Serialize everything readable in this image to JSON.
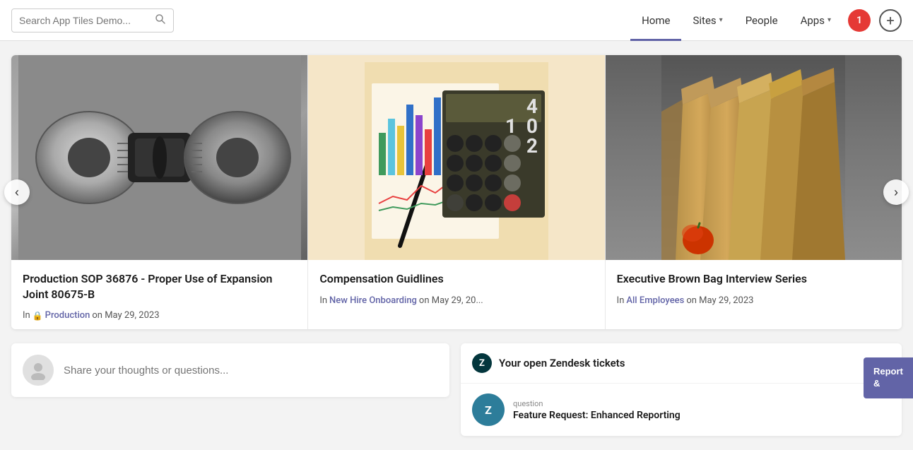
{
  "header": {
    "search_placeholder": "Search App Tiles Demo...",
    "nav_items": [
      {
        "label": "Home",
        "active": true,
        "has_dropdown": false
      },
      {
        "label": "Sites",
        "active": false,
        "has_dropdown": true
      },
      {
        "label": "People",
        "active": false,
        "has_dropdown": false
      },
      {
        "label": "Apps",
        "active": false,
        "has_dropdown": true
      }
    ],
    "user_initial": "1",
    "plus_icon": "+"
  },
  "carousel": {
    "prev_label": "‹",
    "next_label": "›",
    "cards": [
      {
        "id": "card1",
        "title": "Production SOP 36876 - Proper Use of Expansion Joint 80675-B",
        "meta_prefix": "In",
        "meta_link_text": "Production",
        "meta_suffix": "on May 29, 2023",
        "has_lock": true,
        "image_type": "mechanical"
      },
      {
        "id": "card2",
        "title": "Compensation Guidlines",
        "meta_prefix": "In",
        "meta_link_text": "New Hire Onboarding",
        "meta_suffix": "on May 29, 20...",
        "has_lock": false,
        "image_type": "chart"
      },
      {
        "id": "card3",
        "title": "Executive Brown Bag Interview Series",
        "meta_prefix": "In",
        "meta_link_text": "All Employees",
        "meta_suffix": "on May 29, 2023",
        "has_lock": false,
        "image_type": "bags"
      }
    ]
  },
  "share_box": {
    "placeholder": "Share your thoughts or questions..."
  },
  "zendesk": {
    "logo_text": "Z",
    "title": "Your open Zendesk tickets",
    "ticket": {
      "avatar_text": "Z",
      "label": "question",
      "title": "Feature Request: Enhanced Reporting"
    }
  },
  "report_button": {
    "line1": "Report &"
  }
}
